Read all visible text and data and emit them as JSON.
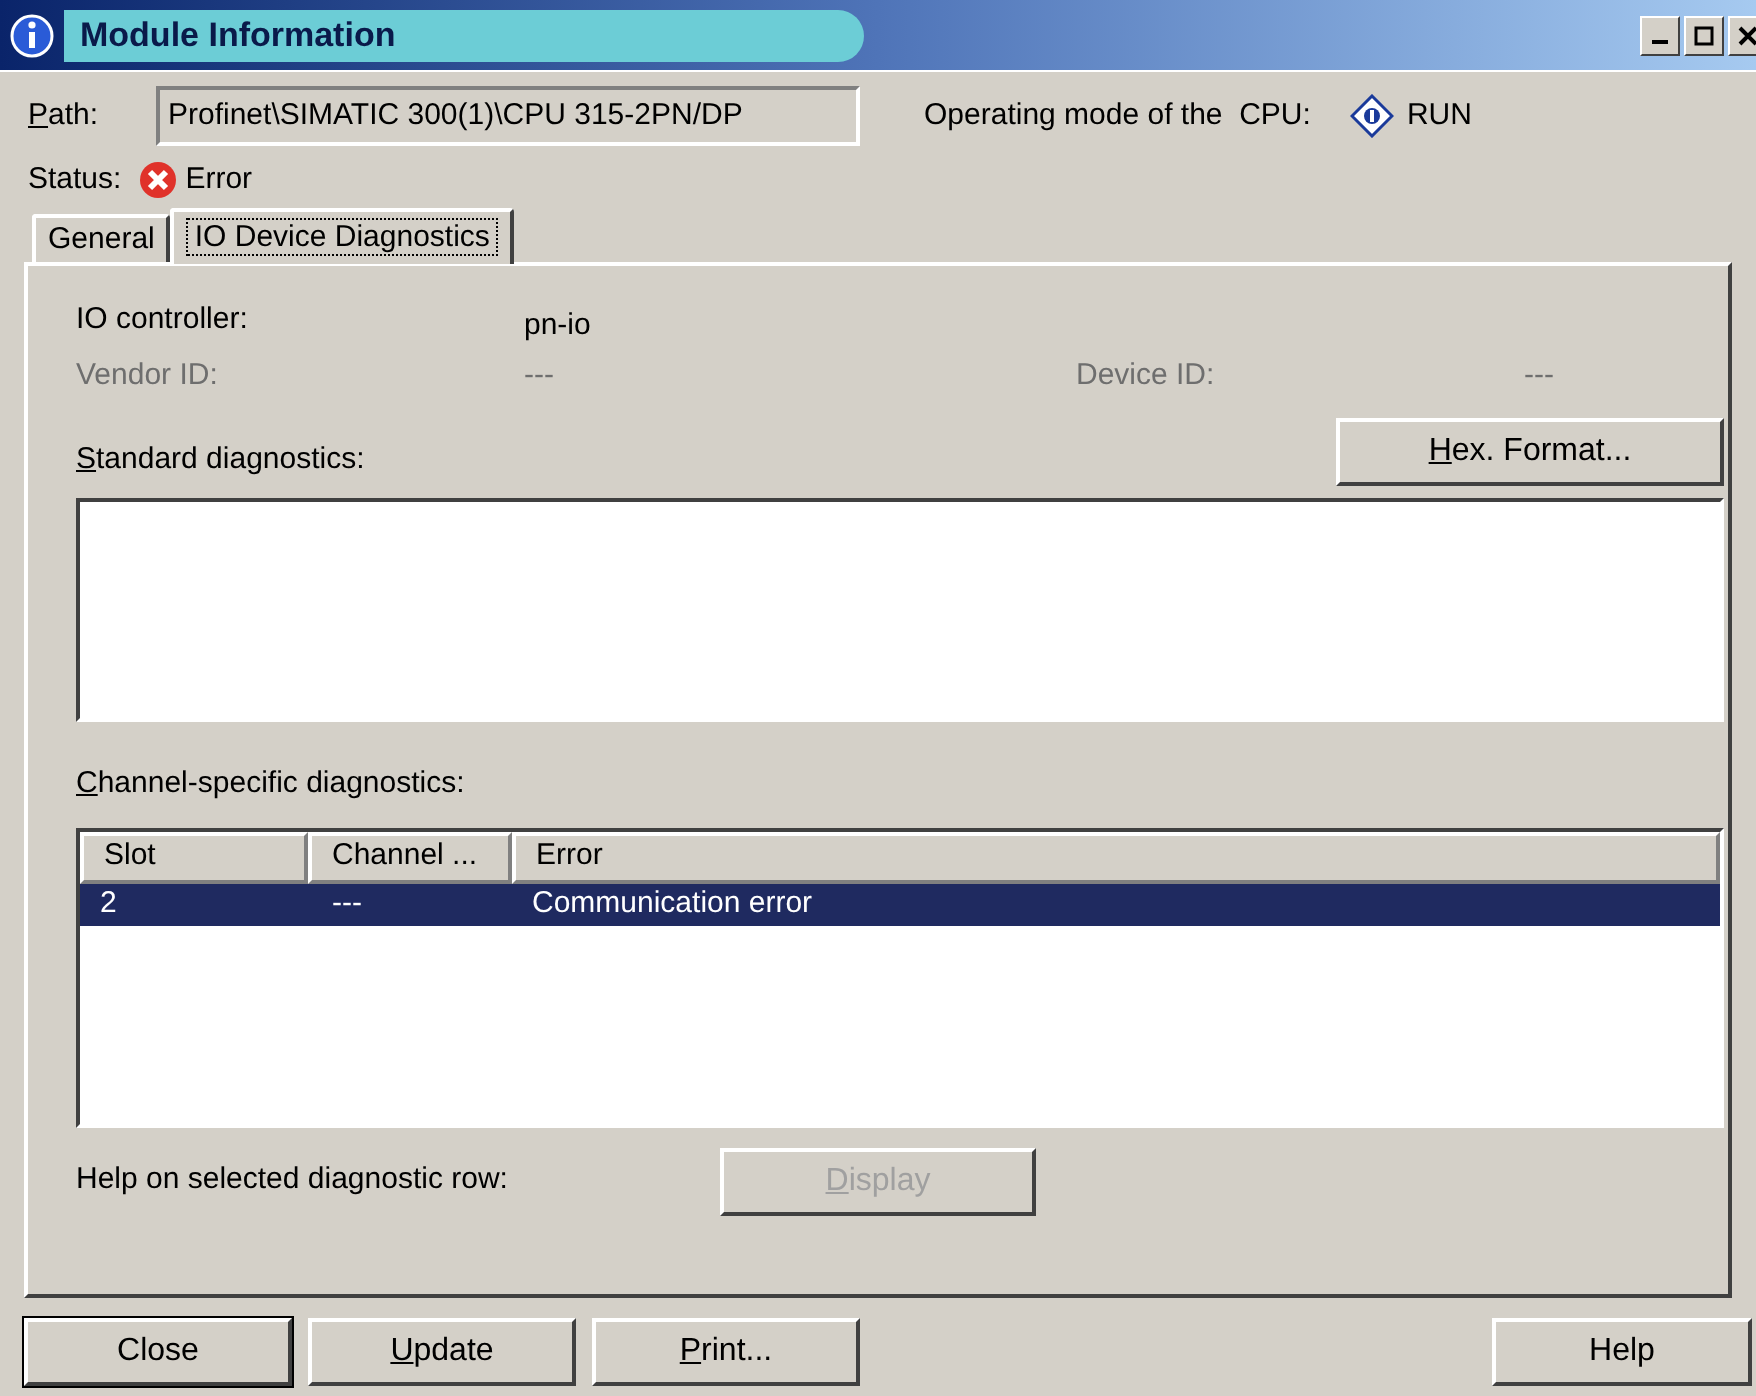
{
  "window": {
    "title": "Module Information"
  },
  "path": {
    "label": "Path:",
    "value": "Profinet\\SIMATIC 300(1)\\CPU 315-2PN/DP"
  },
  "operating_mode": {
    "label": "Operating mode of the  CPU:",
    "value": "RUN"
  },
  "status": {
    "label": "Status:",
    "value": "Error"
  },
  "tabs": [
    {
      "label": "General",
      "selected": false
    },
    {
      "label": "IO Device Diagnostics",
      "selected": true
    }
  ],
  "fields": [
    {
      "label": "IO controller:",
      "value": "pn-io",
      "disabled": false
    },
    {
      "label": "Vendor ID:",
      "value": "---",
      "disabled": true
    },
    {
      "label": "Device ID:",
      "value": "---",
      "disabled": true
    }
  ],
  "hex_button": {
    "label": "Hex. Format..."
  },
  "standard_diagnostics": {
    "label": "Standard diagnostics:"
  },
  "channel_diagnostics": {
    "label": "Channel-specific diagnostics:",
    "columns": [
      "Slot",
      "Channel ...",
      "Error"
    ],
    "rows": [
      {
        "cells": [
          "2",
          "---",
          "Communication error"
        ],
        "selected": true
      }
    ]
  },
  "help_row": {
    "label": "Help on selected diagnostic row:",
    "button": "Display",
    "disabled": true
  },
  "buttons": [
    "Close",
    "Update",
    "Print...",
    "Help"
  ]
}
